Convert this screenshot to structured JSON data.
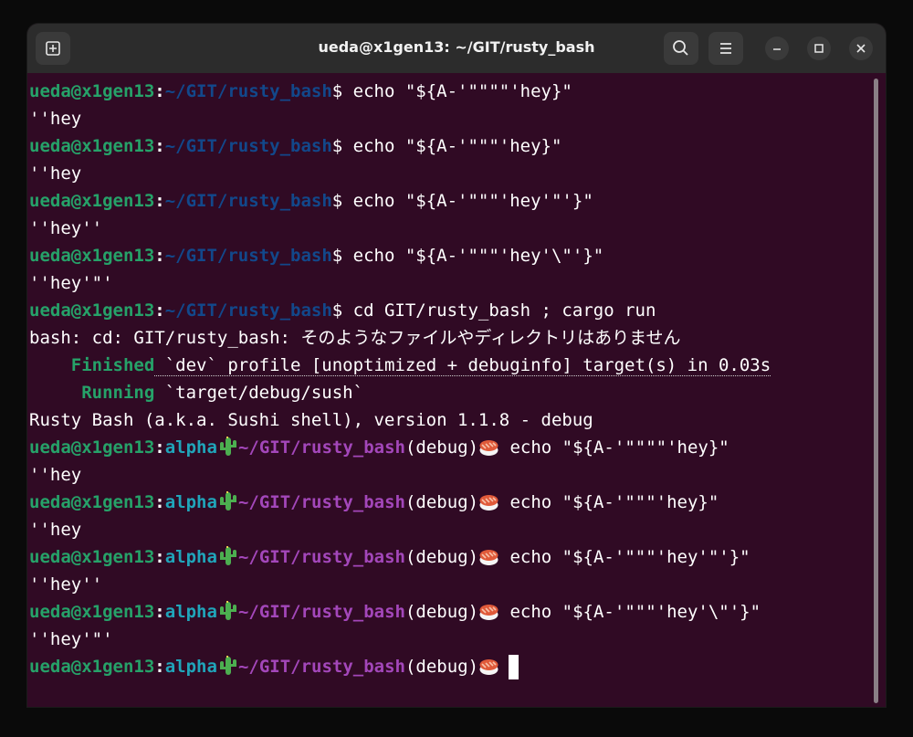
{
  "window": {
    "title": "ueda@x1gen13: ~/GIT/rusty_bash",
    "icons": {
      "new_tab": "new-tab-icon",
      "search": "search-icon",
      "menu": "hamburger-menu-icon",
      "minimize": "minimize-icon",
      "maximize": "maximize-icon",
      "close": "close-icon"
    }
  },
  "colors": {
    "terminal_bg": "#300a24",
    "titlebar_bg": "#2c2c2c",
    "prompt_user": "#26a269",
    "bash_path": "#12488b",
    "sushi_alpha": "#20a5ba",
    "sushi_path": "#a347ba"
  },
  "bash_prompt": {
    "user": "ueda@x1gen13",
    "sep": ":",
    "path": "~/GIT/rusty_bash",
    "dollar": "$"
  },
  "sushi_prompt": {
    "user": "ueda@x1gen13",
    "sep": ":",
    "name": "alpha",
    "path": "~/GIT/rusty_bash",
    "branch": "(debug)",
    "cactus": "cactus-emoji",
    "sushi": "sushi-emoji"
  },
  "bash_commands": [
    " echo \"${A-'\"\"\"\"'hey}\"",
    " echo \"${A-'\"\"\"'hey}\"",
    " echo \"${A-'\"\"\"'hey'\"'}\"",
    " echo \"${A-'\"\"\"'hey'\\\"'}\""
  ],
  "bash_outputs": [
    "''hey",
    "''hey",
    "''hey''",
    "''hey'\"'"
  ],
  "cd_command": " cd GIT/rusty_bash ; cargo run",
  "error_line": "bash: cd: GIT/rusty_bash: そのようなファイルやディレクトリはありません",
  "cargo": {
    "finished_label": "Finished",
    "finished_text": " `dev` profile [unoptimized + debuginfo] target(s) in 0.03s",
    "running_label": "Running",
    "running_text": " `target/debug/sush`"
  },
  "version_line": "Rusty Bash (a.k.a. Sushi shell), version 1.1.8 - debug",
  "sushi_commands": [
    " echo \"${A-'\"\"\"\"'hey}\"",
    " echo \"${A-'\"\"\"'hey}\"",
    " echo \"${A-'\"\"\"'hey'\"'}\"",
    " echo \"${A-'\"\"\"'hey'\\\"'}\""
  ],
  "sushi_outputs": [
    "''hey",
    "''hey",
    "''hey''",
    "''hey'\"'"
  ]
}
